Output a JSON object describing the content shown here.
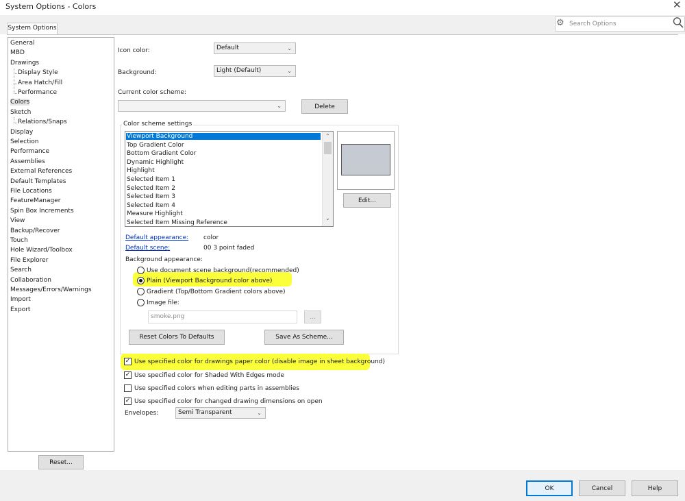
{
  "window": {
    "title": "System Options - Colors",
    "close_icon": "close-icon"
  },
  "tab": {
    "label": "System Options"
  },
  "search": {
    "placeholder": "Search Options"
  },
  "tree": {
    "items": [
      {
        "label": "General",
        "indent": 0
      },
      {
        "label": "MBD",
        "indent": 0
      },
      {
        "label": "Drawings",
        "indent": 0
      },
      {
        "label": "Display Style",
        "indent": 1
      },
      {
        "label": "Area Hatch/Fill",
        "indent": 1
      },
      {
        "label": "Performance",
        "indent": 1
      },
      {
        "label": "Colors",
        "indent": 0,
        "selected": true
      },
      {
        "label": "Sketch",
        "indent": 0
      },
      {
        "label": "Relations/Snaps",
        "indent": 1
      },
      {
        "label": "Display",
        "indent": 0
      },
      {
        "label": "Selection",
        "indent": 0
      },
      {
        "label": "Performance",
        "indent": 0
      },
      {
        "label": "Assemblies",
        "indent": 0
      },
      {
        "label": "External References",
        "indent": 0
      },
      {
        "label": "Default Templates",
        "indent": 0
      },
      {
        "label": "File Locations",
        "indent": 0
      },
      {
        "label": "FeatureManager",
        "indent": 0
      },
      {
        "label": "Spin Box Increments",
        "indent": 0
      },
      {
        "label": "View",
        "indent": 0
      },
      {
        "label": "Backup/Recover",
        "indent": 0
      },
      {
        "label": "Touch",
        "indent": 0
      },
      {
        "label": "Hole Wizard/Toolbox",
        "indent": 0
      },
      {
        "label": "File Explorer",
        "indent": 0
      },
      {
        "label": "Search",
        "indent": 0
      },
      {
        "label": "Collaboration",
        "indent": 0
      },
      {
        "label": "Messages/Errors/Warnings",
        "indent": 0
      },
      {
        "label": "Import",
        "indent": 0
      },
      {
        "label": "Export",
        "indent": 0
      }
    ]
  },
  "reset_button": "Reset...",
  "icon_color": {
    "label": "Icon color:",
    "value": "Default"
  },
  "background": {
    "label": "Background:",
    "value": "Light (Default)"
  },
  "color_scheme": {
    "label": "Current color scheme:",
    "value": "",
    "delete_label": "Delete"
  },
  "scheme_settings": {
    "title": "Color scheme settings",
    "items": [
      "Viewport Background",
      "Top Gradient Color",
      "Bottom Gradient Color",
      "Dynamic Highlight",
      "Highlight",
      "Selected Item 1",
      "Selected Item 2",
      "Selected Item 3",
      "Selected Item 4",
      "Measure Highlight",
      "Selected Item Missing Reference"
    ],
    "selected_index": 0,
    "edit_label": "Edit...",
    "preview_color": "#c6cad3",
    "default_appearance_label": "Default appearance:",
    "default_appearance_value": "color",
    "default_scene_label": "Default scene:",
    "default_scene_value": "00 3 point faded",
    "bg_appearance_label": "Background appearance:",
    "radios": [
      {
        "label": "Use document scene background(recommended)",
        "checked": false
      },
      {
        "label": "Plain (Viewport Background color above)",
        "checked": true
      },
      {
        "label": "Gradient (Top/Bottom Gradient colors above)",
        "checked": false
      },
      {
        "label": "Image file:",
        "checked": false
      }
    ],
    "image_file_value": "smoke.png",
    "browse_label": "...",
    "reset_colors_label": "Reset Colors To Defaults",
    "save_scheme_label": "Save As Scheme..."
  },
  "checkboxes": [
    {
      "label": "Use specified color for drawings paper color (disable image in sheet background)",
      "checked": true
    },
    {
      "label": "Use specified color for Shaded With Edges mode",
      "checked": true
    },
    {
      "label": "Use specified colors when editing parts in assemblies",
      "checked": false
    },
    {
      "label": "Use specified color for changed drawing dimensions on open",
      "checked": true
    }
  ],
  "envelopes": {
    "label": "Envelopes:",
    "value": "Semi Transparent"
  },
  "footer": {
    "ok_label": "OK",
    "cancel_label": "Cancel",
    "help_label": "Help"
  },
  "colors": {
    "highlight": "#fbff2e",
    "selection": "#0078d7"
  }
}
